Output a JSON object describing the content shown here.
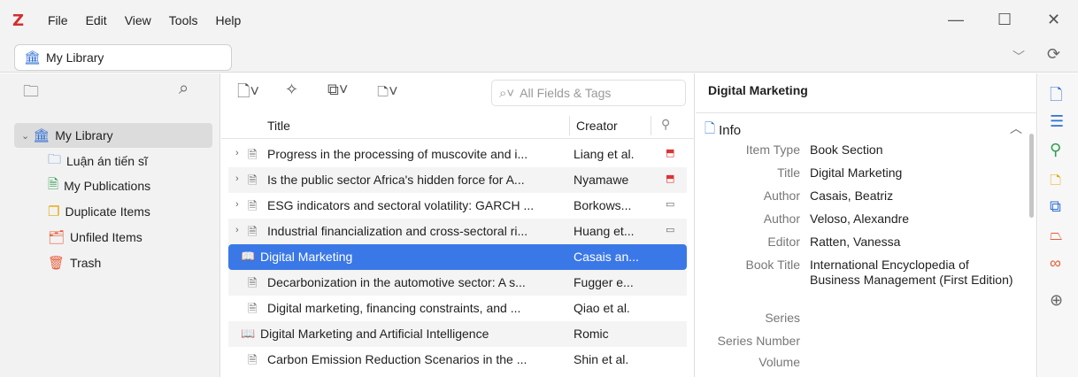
{
  "menubar": {
    "logo": "Z",
    "items": [
      "File",
      "Edit",
      "View",
      "Tools",
      "Help"
    ],
    "minimize": "—",
    "maximize": "☐",
    "close": "✕"
  },
  "library_tab": {
    "label": "My Library",
    "chevron": "﹀",
    "sync_icon": "⟳"
  },
  "left_pane": {
    "tree": [
      {
        "label": "My Library",
        "icon": "library-icon",
        "glyph": "🏛",
        "color": "#2f6fd6"
      },
      {
        "label": "Luận án tiến sĩ",
        "icon": "folder-icon",
        "glyph": "🗀",
        "color": "#2f6fd6"
      },
      {
        "label": "My Publications",
        "icon": "publications-icon",
        "glyph": "🗎",
        "color": "#2e9e4f"
      },
      {
        "label": "Duplicate Items",
        "icon": "duplicate-icon",
        "glyph": "❐",
        "color": "#e6a700"
      },
      {
        "label": "Unfiled Items",
        "icon": "unfiled-icon",
        "glyph": "🗂",
        "color": "#e85d3a"
      },
      {
        "label": "Trash",
        "icon": "trash-icon",
        "glyph": "🗑",
        "color": "#e85d3a"
      }
    ]
  },
  "middle_pane": {
    "search_placeholder": "All Fields & Tags",
    "columns": {
      "title": "Title",
      "creator": "Creator"
    },
    "items": [
      {
        "title": "Progress in the processing of muscovite and i...",
        "creator": "Liang et al.",
        "attachment": "pdf",
        "twisty": "›",
        "type": "document"
      },
      {
        "title": "Is the public sector Africa's hidden force for A...",
        "creator": "Nyamawe",
        "attachment": "pdf",
        "twisty": "›",
        "type": "document"
      },
      {
        "title": "ESG indicators and sectoral volatility: GARCH ...",
        "creator": "Borkows...",
        "attachment": "snapshot",
        "twisty": "›",
        "type": "document"
      },
      {
        "title": "Industrial financialization and cross-sectoral ri...",
        "creator": "Huang et...",
        "attachment": "snapshot",
        "twisty": "›",
        "type": "document"
      },
      {
        "title": "Digital Marketing",
        "creator": "Casais an...",
        "attachment": "",
        "twisty": "",
        "type": "book",
        "selected": true
      },
      {
        "title": "Decarbonization in the automotive sector: A s...",
        "creator": "Fugger e...",
        "attachment": "",
        "twisty": "",
        "type": "document"
      },
      {
        "title": "Digital marketing, financing constraints, and ...",
        "creator": "Qiao et al.",
        "attachment": "",
        "twisty": "",
        "type": "document"
      },
      {
        "title": "Digital Marketing and Artificial Intelligence",
        "creator": "Romic",
        "attachment": "",
        "twisty": "",
        "type": "book"
      },
      {
        "title": "Carbon Emission Reduction Scenarios in the ...",
        "creator": "Shin et al.",
        "attachment": "",
        "twisty": "",
        "type": "document"
      }
    ]
  },
  "right_pane": {
    "header": "Digital Marketing",
    "section": "Info",
    "fields": [
      {
        "label": "Item Type",
        "value": "Book Section"
      },
      {
        "label": "Title",
        "value": "Digital Marketing"
      },
      {
        "label": "Author",
        "value": "Casais, Beatriz"
      },
      {
        "label": "Author",
        "value": "Veloso, Alexandre"
      },
      {
        "label": "Editor",
        "value": "Ratten, Vanessa"
      },
      {
        "label": "Book Title",
        "value": "International Encyclopedia of Business Management (First Edition)"
      },
      {
        "label": "Series",
        "value": ""
      },
      {
        "label": "Series Number",
        "value": ""
      },
      {
        "label": "Volume",
        "value": ""
      }
    ]
  },
  "side_strip": {
    "icons": [
      {
        "name": "info-pane-icon",
        "glyph": "🗋",
        "color": "#2f6fd6"
      },
      {
        "name": "abstract-icon",
        "glyph": "☰",
        "color": "#2f6fd6"
      },
      {
        "name": "attachments-icon",
        "glyph": "⚲",
        "color": "#2e9e4f"
      },
      {
        "name": "notes-icon",
        "glyph": "🗅",
        "color": "#e6a700"
      },
      {
        "name": "libraries-collections-icon",
        "glyph": "⧉",
        "color": "#2f6fd6"
      },
      {
        "name": "tags-icon",
        "glyph": "⏢",
        "color": "#e85d3a"
      },
      {
        "name": "related-icon",
        "glyph": "∞",
        "color": "#e85d3a"
      },
      {
        "name": "locate-icon",
        "glyph": "⊕",
        "color": "#666666"
      }
    ]
  }
}
